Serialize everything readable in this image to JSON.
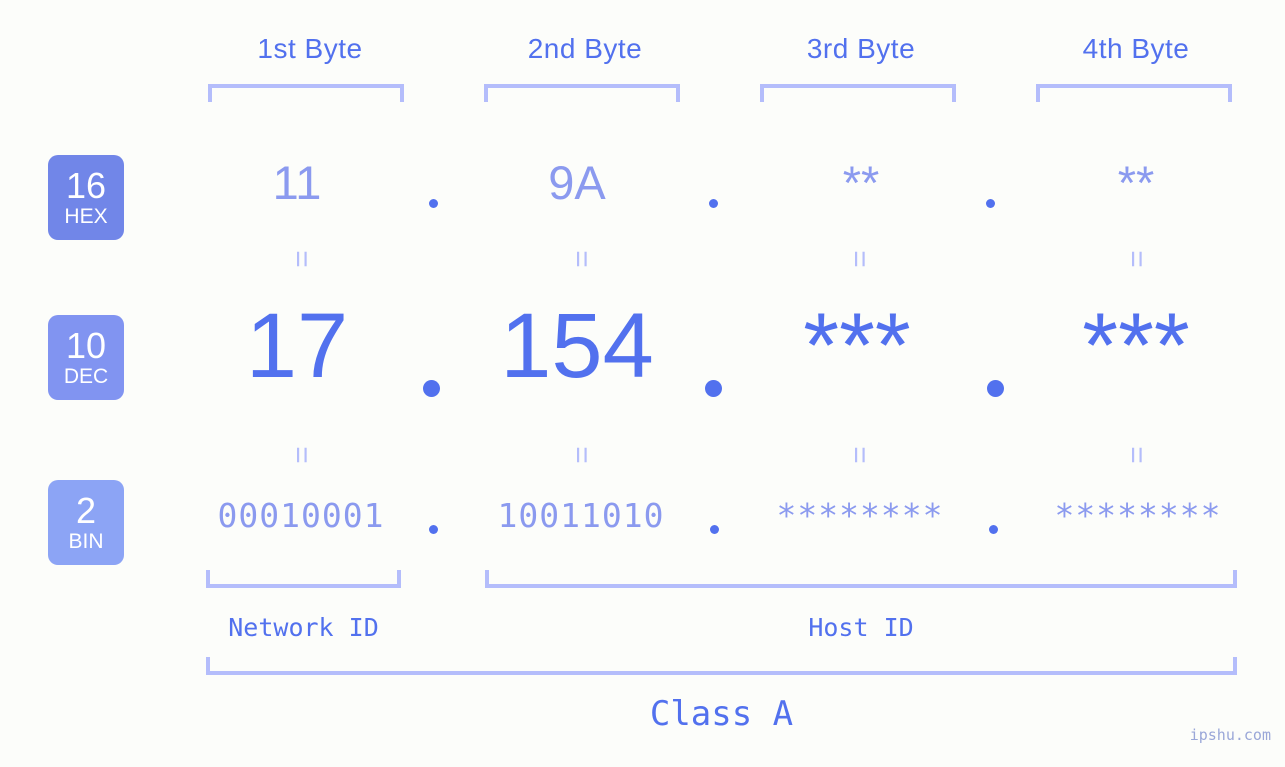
{
  "meta": {
    "background_color": "#fcfdfa",
    "accent_strong": "#5271ee",
    "accent_light": "#8b9aef",
    "accent_pale": "#b4bdfb"
  },
  "byte_headers": [
    {
      "label": "1st Byte"
    },
    {
      "label": "2nd Byte"
    },
    {
      "label": "3rd Byte"
    },
    {
      "label": "4th Byte"
    }
  ],
  "radix_badges": [
    {
      "number": "16",
      "name": "HEX",
      "color": "#7186e8"
    },
    {
      "number": "10",
      "name": "DEC",
      "color": "#8194f1"
    },
    {
      "number": "2",
      "name": "BIN",
      "color": "#8ca4f5"
    }
  ],
  "rows": {
    "hex": {
      "values": [
        "11",
        "9A",
        "**",
        "**"
      ],
      "separator": "."
    },
    "dec": {
      "values": [
        "17",
        "154",
        "***",
        "***"
      ],
      "separator": "."
    },
    "bin": {
      "values": [
        "00010001",
        "10011010",
        "********",
        "********"
      ],
      "separator": "."
    }
  },
  "equals_marks": {
    "glyph": "=",
    "count_per_row": 4
  },
  "segments": {
    "network_id": "Network ID",
    "host_id": "Host ID",
    "class": "Class A"
  },
  "watermark": "ipshu.com"
}
